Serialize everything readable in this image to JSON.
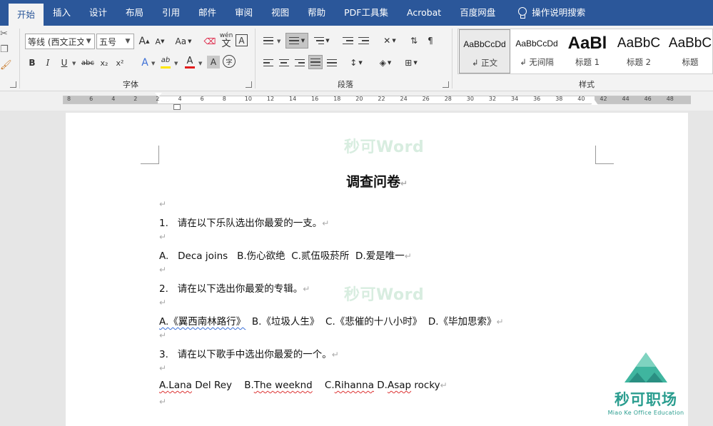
{
  "tabs": [
    "开始",
    "插入",
    "设计",
    "布局",
    "引用",
    "邮件",
    "审阅",
    "视图",
    "帮助",
    "PDF工具集",
    "Acrobat",
    "百度网盘"
  ],
  "tell_me": "操作说明搜索",
  "font": {
    "name": "等线 (西文正文",
    "size": "五号",
    "grow": "A",
    "shrink": "A",
    "case": "Aa",
    "phonetic": "wén",
    "phonetic_char": "文",
    "border_char": "A",
    "bold": "B",
    "italic": "I",
    "underline": "U",
    "strike": "abc",
    "sub": "x₂",
    "sup": "x²",
    "effects": "A",
    "highlight": "ab",
    "color": "A",
    "shade": "A",
    "enclose": "字",
    "label": "字体"
  },
  "paragraph_label": "段落",
  "styles": {
    "label": "样式",
    "items": [
      {
        "sample": "AaBbCcDd",
        "name": "↲ 正文"
      },
      {
        "sample": "AaBbCcDd",
        "name": "↲ 无间隔"
      },
      {
        "sample": "AaBl",
        "name": "标题 1"
      },
      {
        "sample": "AaBbC",
        "name": "标题 2"
      },
      {
        "sample": "AaBbC",
        "name": "标题"
      }
    ]
  },
  "ruler_ticks": [
    "8",
    "6",
    "4",
    "2",
    "2",
    "4",
    "6",
    "8",
    "10",
    "12",
    "14",
    "16",
    "18",
    "20",
    "22",
    "24",
    "26",
    "28",
    "30",
    "32",
    "34",
    "36",
    "38",
    "40",
    "42",
    "44",
    "46",
    "48"
  ],
  "colors": {
    "brand": "#2b579a",
    "highlight": "#ffe600",
    "font_color": "#e21b1b",
    "watermark": "#d8ede0",
    "logo": "#2a9d8f"
  },
  "document": {
    "watermark": "秒可Word",
    "title": "调查问卷",
    "q1": "1.   请在以下乐队选出你最爱的一支。",
    "q1_options": "A.   Deca joins   B.伤心欲绝  C.贰伍吸菸所  D.爱是唯一",
    "q2": "2.   请在以下选出你最爱的专辑。",
    "q2_option_a": "A.《翼西南林路行》",
    "q2_options_rest": "  B.《垃圾人生》  C.《悲催的十八小时》  D.《毕加思索》",
    "q3": "3.   请在以下歌手中选出你最爱的一个。",
    "q3_a_prefix": "A.",
    "q3_a_name": "Lana",
    "q3_a_rest": " Del Rey",
    "q3_b_prefix": "    B.",
    "q3_b_name": "The weeknd",
    "q3_c_prefix": "    C.",
    "q3_c_name": "Rihanna",
    "q3_d_sep": " D.",
    "q3_d_name": "Asap",
    "q3_d_rest": " rocky",
    "para_mark": "↵"
  },
  "logo": {
    "name": "秒可职场",
    "tagline": "Miao Ke Office Education"
  }
}
